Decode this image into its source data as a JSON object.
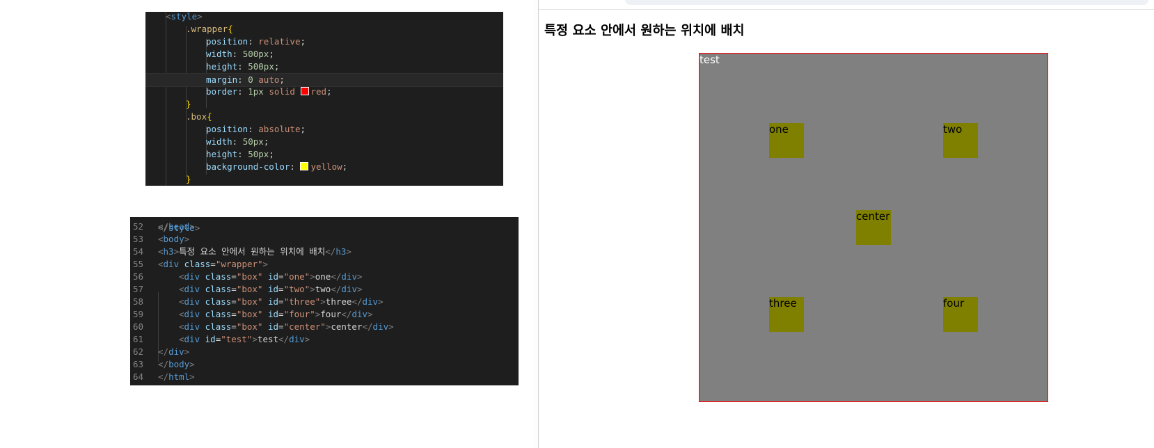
{
  "css_code": {
    "lines": [
      {
        "text": "<style>"
      },
      {
        "text": ".wrapper{"
      },
      {
        "prop": "position",
        "value": "relative"
      },
      {
        "prop": "width",
        "value": "500px"
      },
      {
        "prop": "height",
        "value": "500px"
      },
      {
        "prop": "margin",
        "value": "0 auto"
      },
      {
        "prop": "border",
        "value_a": "1px solid",
        "value_b": "red",
        "swatch": "#ff0000"
      },
      {
        "text": "}"
      },
      {
        "text": ".box{"
      },
      {
        "prop": "position",
        "value": "absolute"
      },
      {
        "prop": "width",
        "value": "50px"
      },
      {
        "prop": "height",
        "value": "50px"
      },
      {
        "prop": "background-color",
        "value_b": "yellow",
        "swatch": "#ffff00"
      },
      {
        "text": "}"
      }
    ]
  },
  "html_code": {
    "line_numbers": [
      "52",
      "53",
      "54",
      "55",
      "56",
      "57",
      "58",
      "59",
      "60",
      "61",
      "62",
      "63",
      "64"
    ],
    "h3_text": "특정 요소 안에서 원하는 위치에 배치",
    "boxes": [
      {
        "id": "one",
        "text": "one"
      },
      {
        "id": "two",
        "text": "two"
      },
      {
        "id": "three",
        "text": "three"
      },
      {
        "id": "four",
        "text": "four"
      },
      {
        "id": "center",
        "text": "center"
      }
    ],
    "test": {
      "id": "test",
      "text": "test"
    }
  },
  "page": {
    "heading": "특정 요소 안에서 원하는 위치에 배치",
    "test_label": "test",
    "box_labels": {
      "one": "one",
      "two": "two",
      "three": "three",
      "four": "four",
      "center": "center"
    }
  },
  "colors": {
    "wrapper_background": "#808080",
    "wrapper_border": "#ff0000",
    "box_background": "#808000",
    "editor_background": "#1e1e1e"
  }
}
